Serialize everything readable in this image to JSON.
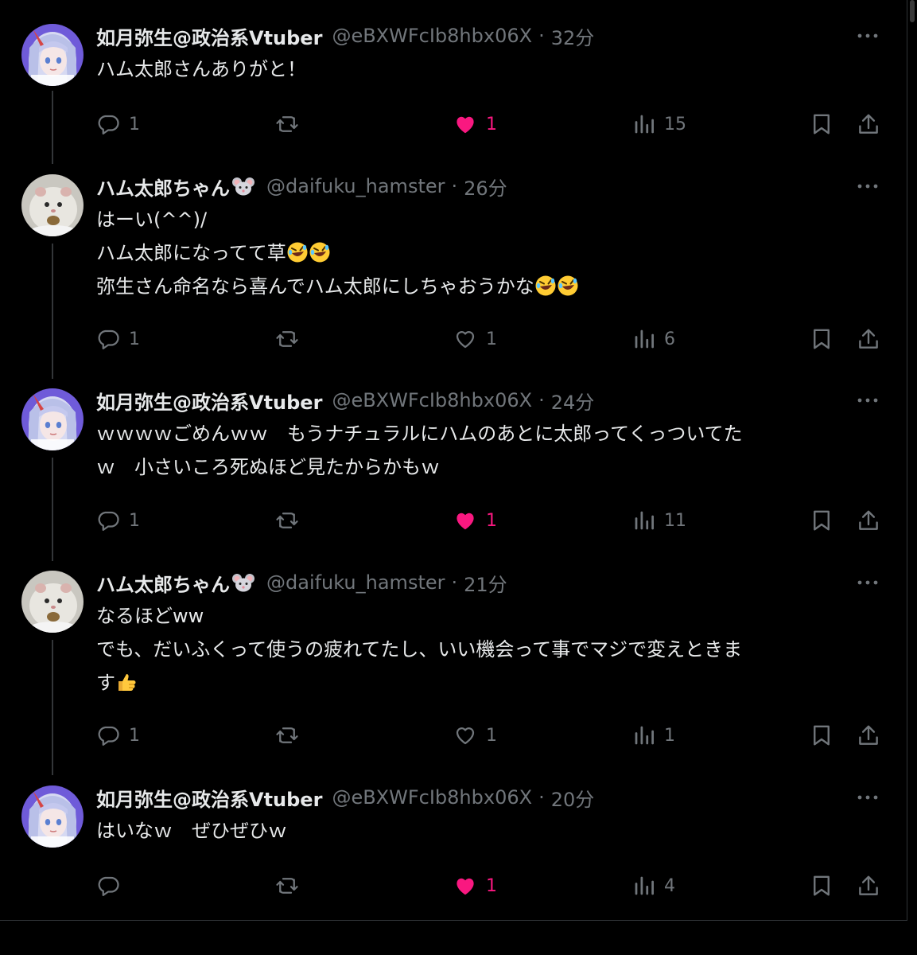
{
  "colors": {
    "background": "#000000",
    "text": "#e7e9ea",
    "secondary": "#71767b",
    "like_active": "#f91880",
    "thread_line": "#333639"
  },
  "separator": "·",
  "tweets": [
    {
      "display_name": "如月弥生@政治系Vtuber",
      "handle": "@eBXWFcIb8hbx06X",
      "time": "32分",
      "avatar": "anime-girl-avatar",
      "lines": [
        "ハム太郎さんありがと！"
      ],
      "replies": "1",
      "retweets": "",
      "likes": "1",
      "liked": true,
      "views": "15"
    },
    {
      "display_name": "ハム太郎ちゃん",
      "name_emoji": "mouse-emoji",
      "handle": "@daifuku_hamster",
      "time": "26分",
      "avatar": "hamster-avatar",
      "lines": [
        "はーい(^^)/",
        "ハム太郎になってて草",
        "弥生さん命名なら喜んでハム太郎にしちゃおうかな"
      ],
      "line_emojis": [
        "",
        "rolling-laughing-emoji x2",
        "rolling-laughing-emoji x2"
      ],
      "replies": "1",
      "retweets": "",
      "likes": "1",
      "liked": false,
      "views": "6"
    },
    {
      "display_name": "如月弥生@政治系Vtuber",
      "handle": "@eBXWFcIb8hbx06X",
      "time": "24分",
      "avatar": "anime-girl-avatar",
      "lines": [
        "ｗｗｗｗごめんｗｗ　もうナチュラルにハムのあとに太郎ってくっついてた",
        "ｗ　小さいころ死ぬほど見たからかもｗ"
      ],
      "replies": "1",
      "retweets": "",
      "likes": "1",
      "liked": true,
      "views": "11"
    },
    {
      "display_name": "ハム太郎ちゃん",
      "name_emoji": "mouse-emoji",
      "handle": "@daifuku_hamster",
      "time": "21分",
      "avatar": "hamster-avatar",
      "lines": [
        "なるほどww",
        "でも、だいふくって使うの疲れてたし、いい機会って事でマジで変えときま",
        "す"
      ],
      "line_emojis": [
        "",
        "",
        "thumbs-up-emoji"
      ],
      "replies": "1",
      "retweets": "",
      "likes": "1",
      "liked": false,
      "views": "1"
    },
    {
      "display_name": "如月弥生@政治系Vtuber",
      "handle": "@eBXWFcIb8hbx06X",
      "time": "20分",
      "avatar": "anime-girl-avatar",
      "lines": [
        "はいなｗ　ぜひぜひｗ"
      ],
      "replies": "",
      "retweets": "",
      "likes": "1",
      "liked": true,
      "views": "4"
    }
  ]
}
